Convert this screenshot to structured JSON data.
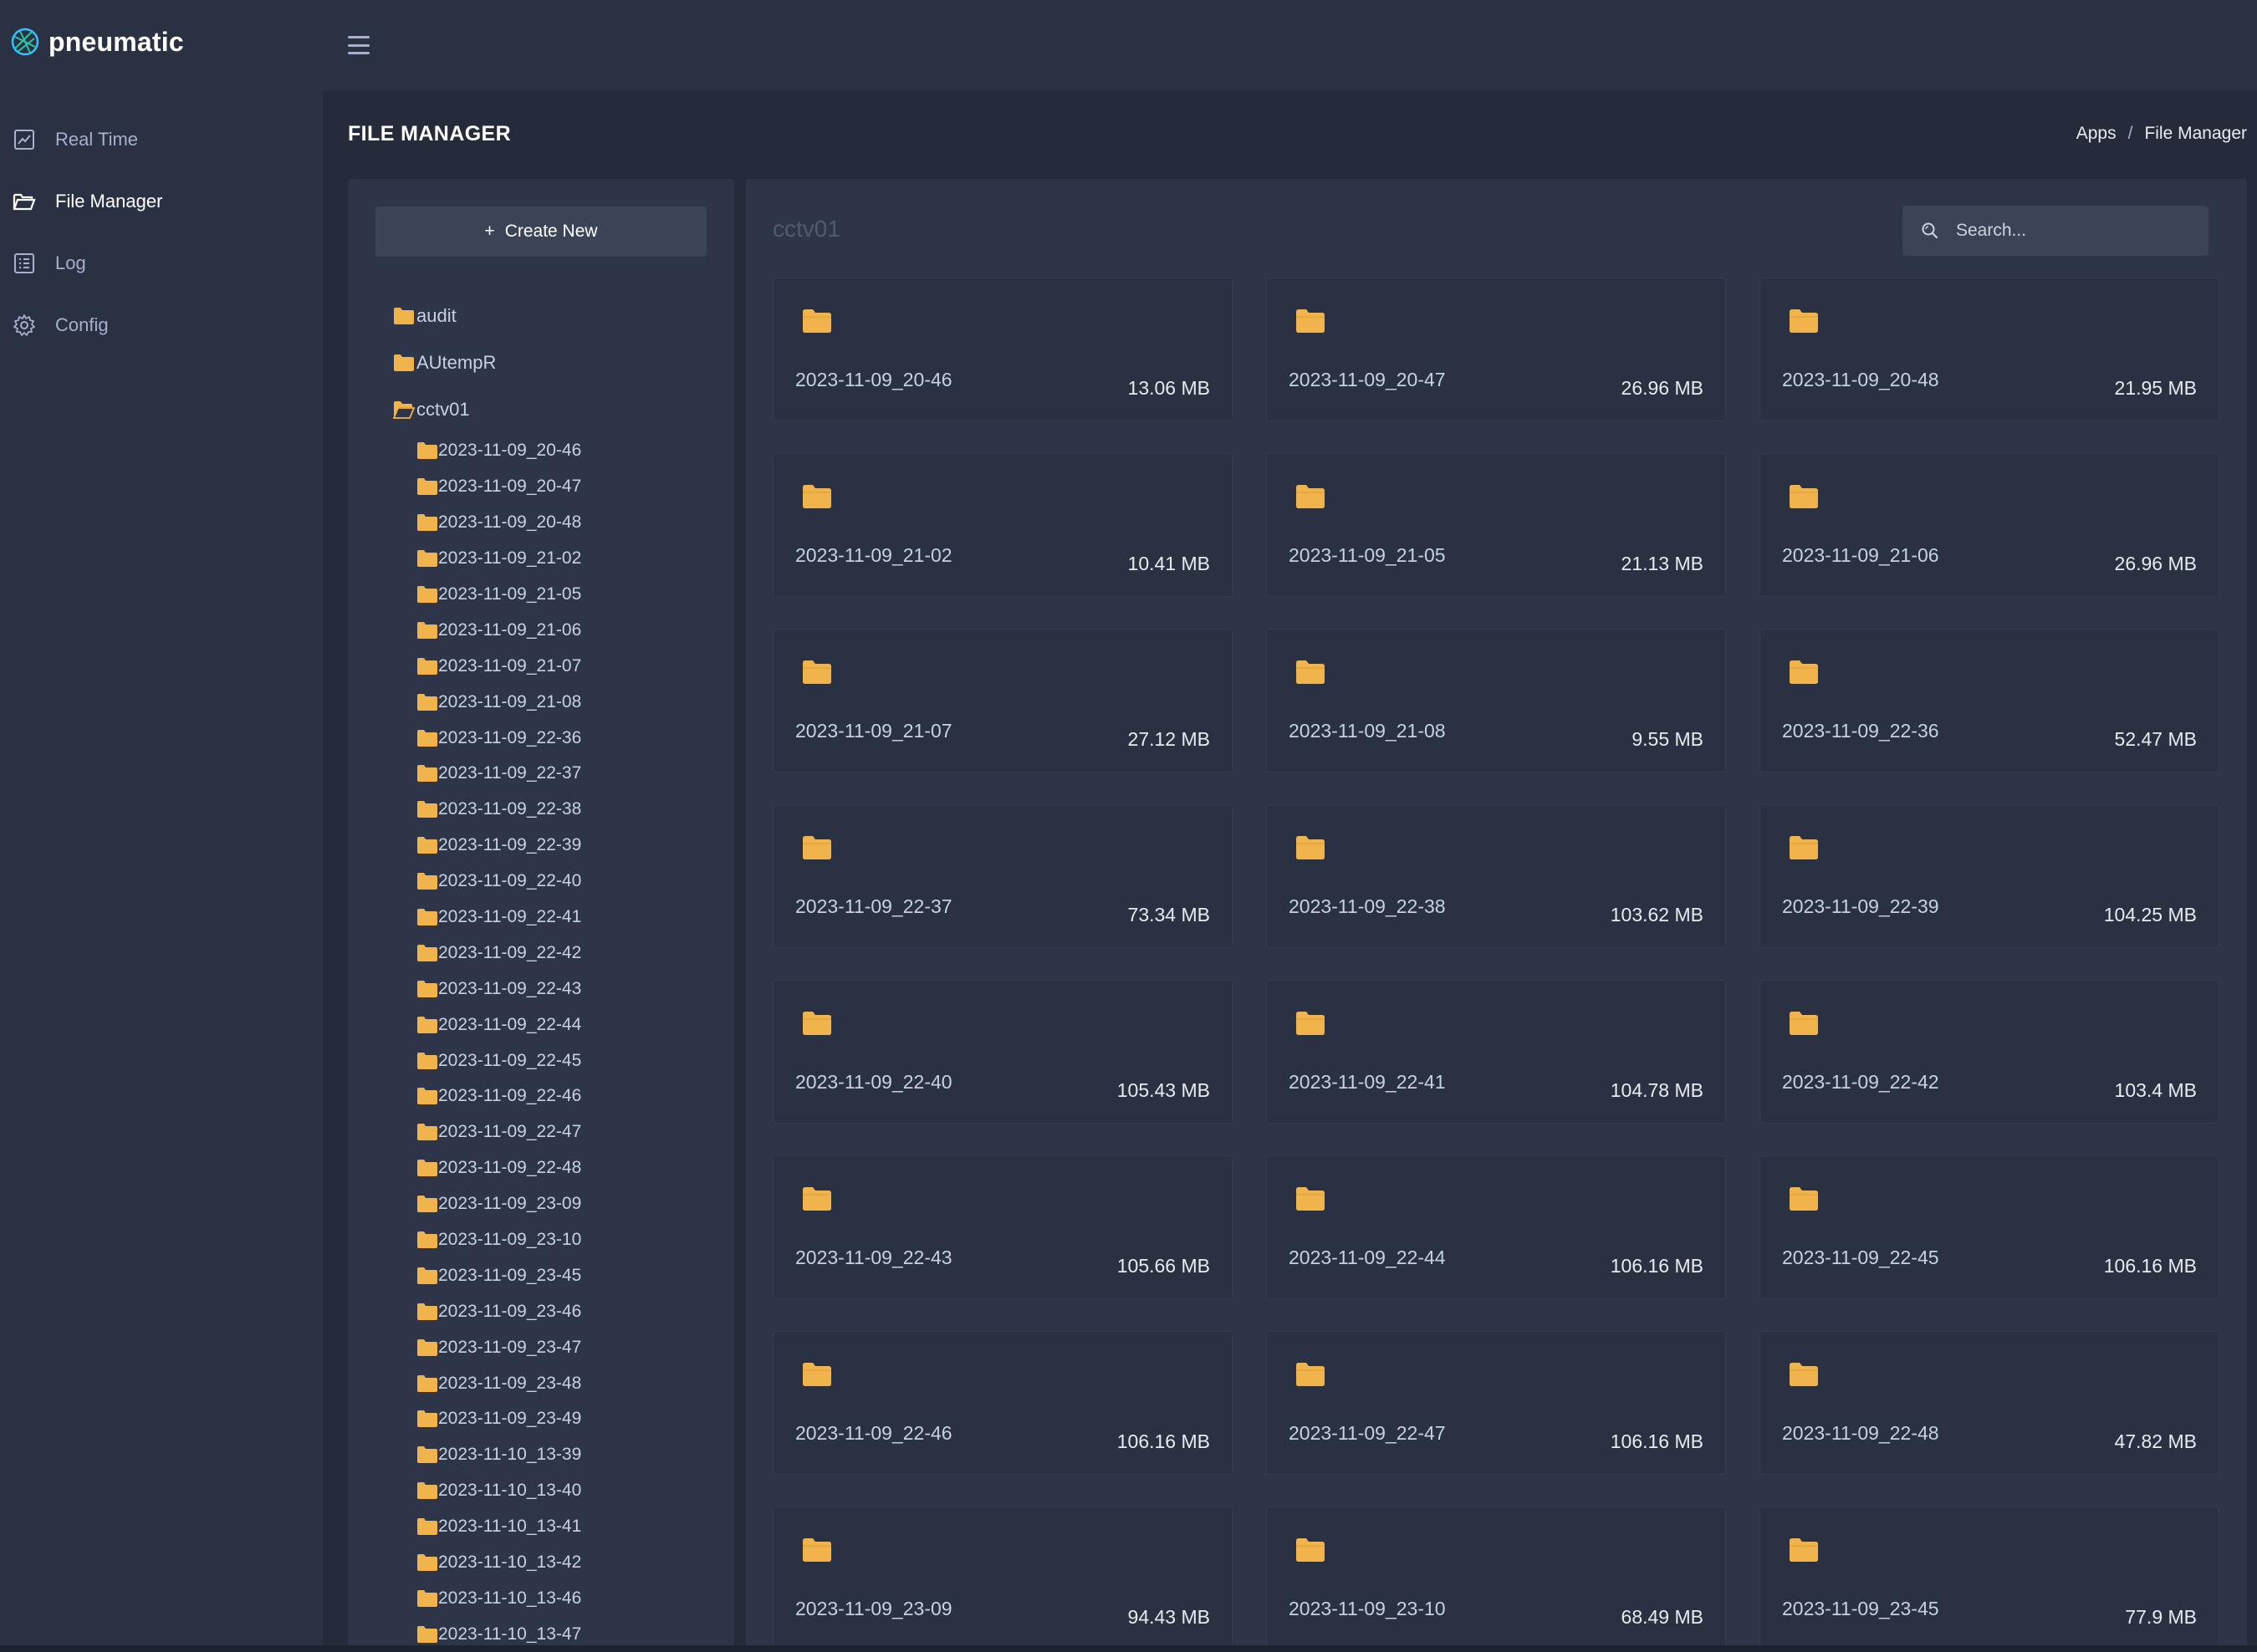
{
  "brand": {
    "name": "pneumatic"
  },
  "sidebar": {
    "items": [
      {
        "label": "Real Time",
        "icon": "chart-line-icon",
        "active": false
      },
      {
        "label": "File Manager",
        "icon": "folder-open-icon",
        "active": true
      },
      {
        "label": "Log",
        "icon": "list-icon",
        "active": false
      },
      {
        "label": "Config",
        "icon": "gear-icon",
        "active": false
      }
    ]
  },
  "page": {
    "title": "FILE MANAGER"
  },
  "breadcrumb": {
    "items": [
      "Apps",
      "File Manager"
    ],
    "separator": "/"
  },
  "tree": {
    "create_label": "Create New",
    "roots": [
      {
        "label": "audit",
        "open": false
      },
      {
        "label": "AUtempR",
        "open": false
      },
      {
        "label": "cctv01",
        "open": true
      }
    ],
    "children": [
      "2023-11-09_20-46",
      "2023-11-09_20-47",
      "2023-11-09_20-48",
      "2023-11-09_21-02",
      "2023-11-09_21-05",
      "2023-11-09_21-06",
      "2023-11-09_21-07",
      "2023-11-09_21-08",
      "2023-11-09_22-36",
      "2023-11-09_22-37",
      "2023-11-09_22-38",
      "2023-11-09_22-39",
      "2023-11-09_22-40",
      "2023-11-09_22-41",
      "2023-11-09_22-42",
      "2023-11-09_22-43",
      "2023-11-09_22-44",
      "2023-11-09_22-45",
      "2023-11-09_22-46",
      "2023-11-09_22-47",
      "2023-11-09_22-48",
      "2023-11-09_23-09",
      "2023-11-09_23-10",
      "2023-11-09_23-45",
      "2023-11-09_23-46",
      "2023-11-09_23-47",
      "2023-11-09_23-48",
      "2023-11-09_23-49",
      "2023-11-10_13-39",
      "2023-11-10_13-40",
      "2023-11-10_13-41",
      "2023-11-10_13-42",
      "2023-11-10_13-46",
      "2023-11-10_13-47"
    ]
  },
  "content": {
    "folder_title": "cctv01",
    "search_placeholder": "Search...",
    "cards": [
      {
        "name": "2023-11-09_20-46",
        "size": "13.06 MB"
      },
      {
        "name": "2023-11-09_20-47",
        "size": "26.96 MB"
      },
      {
        "name": "2023-11-09_20-48",
        "size": "21.95 MB"
      },
      {
        "name": "2023-11-09_21-02",
        "size": "10.41 MB"
      },
      {
        "name": "2023-11-09_21-05",
        "size": "21.13 MB"
      },
      {
        "name": "2023-11-09_21-06",
        "size": "26.96 MB"
      },
      {
        "name": "2023-11-09_21-07",
        "size": "27.12 MB"
      },
      {
        "name": "2023-11-09_21-08",
        "size": "9.55 MB"
      },
      {
        "name": "2023-11-09_22-36",
        "size": "52.47 MB"
      },
      {
        "name": "2023-11-09_22-37",
        "size": "73.34 MB"
      },
      {
        "name": "2023-11-09_22-38",
        "size": "103.62 MB"
      },
      {
        "name": "2023-11-09_22-39",
        "size": "104.25 MB"
      },
      {
        "name": "2023-11-09_22-40",
        "size": "105.43 MB"
      },
      {
        "name": "2023-11-09_22-41",
        "size": "104.78 MB"
      },
      {
        "name": "2023-11-09_22-42",
        "size": "103.4 MB"
      },
      {
        "name": "2023-11-09_22-43",
        "size": "105.66 MB"
      },
      {
        "name": "2023-11-09_22-44",
        "size": "106.16 MB"
      },
      {
        "name": "2023-11-09_22-45",
        "size": "106.16 MB"
      },
      {
        "name": "2023-11-09_22-46",
        "size": "106.16 MB"
      },
      {
        "name": "2023-11-09_22-47",
        "size": "106.16 MB"
      },
      {
        "name": "2023-11-09_22-48",
        "size": "47.82 MB"
      },
      {
        "name": "2023-11-09_23-09",
        "size": "94.43 MB"
      },
      {
        "name": "2023-11-09_23-10",
        "size": "68.49 MB"
      },
      {
        "name": "2023-11-09_23-45",
        "size": "77.9 MB"
      }
    ]
  },
  "colors": {
    "background": "#252b3b",
    "sidebar": "#2a3142",
    "panel": "#2e3548",
    "folder": "#f1b44c",
    "accent": "#34c3ff"
  }
}
